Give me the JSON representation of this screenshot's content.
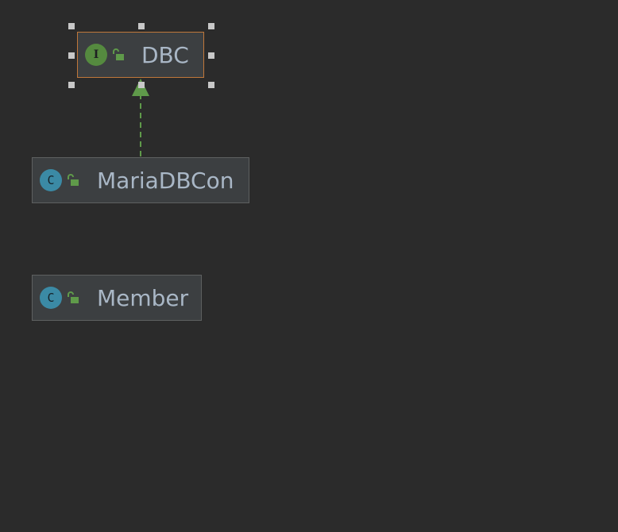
{
  "diagram": {
    "nodes": [
      {
        "id": "dbc",
        "name": "DBC",
        "kind": "interface",
        "kind_glyph": "I",
        "visibility_icon": "unlocked-icon",
        "selected": true
      },
      {
        "id": "mariadbcon",
        "name": "MariaDBCon",
        "kind": "class",
        "kind_glyph": "C",
        "visibility_icon": "unlocked-icon",
        "selected": false
      },
      {
        "id": "member",
        "name": "Member",
        "kind": "class",
        "kind_glyph": "C",
        "visibility_icon": "unlocked-icon",
        "selected": false
      }
    ],
    "edges": [
      {
        "from": "mariadbcon",
        "to": "dbc",
        "type": "implements",
        "style": "dashed",
        "arrow": "hollow-triangle"
      }
    ]
  },
  "colors": {
    "background": "#2b2b2b",
    "node_fill": "#3c3f41",
    "node_border": "#5e6060",
    "selected_border": "#c0773a",
    "interface_icon": "#558a3f",
    "class_icon": "#3b8aa5",
    "edge": "#5f9a4a",
    "text": "#a9b7c6"
  }
}
